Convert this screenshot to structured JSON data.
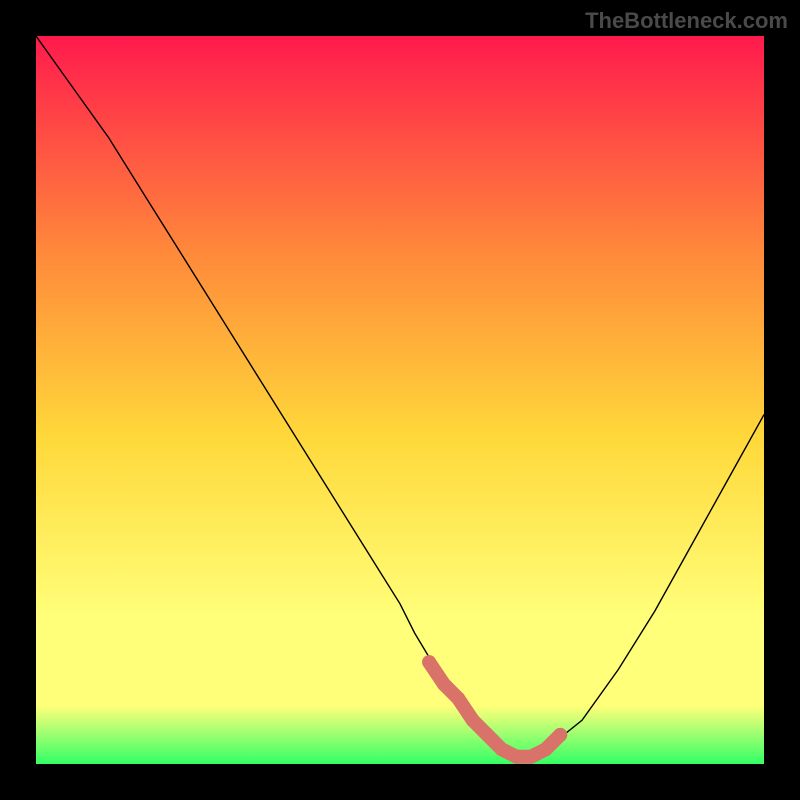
{
  "watermark": "TheBottleneck.com",
  "colors": {
    "frame_bg": "#000000",
    "curve_stroke": "#000000",
    "marker_fill": "#d9736a",
    "gradient_top": "#ff1a4d",
    "gradient_mid1": "#ff8a3a",
    "gradient_mid2": "#ffd83a",
    "gradient_mid3": "#ffff7a",
    "gradient_bot": "#33ff66"
  },
  "chart_data": {
    "type": "line",
    "title": "",
    "xlabel": "",
    "ylabel": "",
    "xlim": [
      0,
      100
    ],
    "ylim": [
      0,
      100
    ],
    "series": [
      {
        "name": "bottleneck-curve",
        "x": [
          0,
          5,
          10,
          15,
          20,
          25,
          30,
          35,
          40,
          45,
          50,
          52,
          55,
          58,
          60,
          62,
          65,
          68,
          70,
          75,
          80,
          85,
          90,
          95,
          100
        ],
        "values": [
          100,
          93,
          86,
          78,
          70,
          62,
          54,
          46,
          38,
          30,
          22,
          18,
          13,
          9,
          6,
          4,
          2,
          1,
          2,
          6,
          13,
          21,
          30,
          39,
          48
        ]
      }
    ],
    "markers": {
      "name": "highlight-region",
      "x": [
        54,
        56,
        58,
        60,
        62,
        64,
        66,
        68,
        70,
        72
      ],
      "values": [
        14,
        11,
        9,
        6,
        4,
        2,
        1,
        1,
        2,
        4
      ]
    }
  }
}
